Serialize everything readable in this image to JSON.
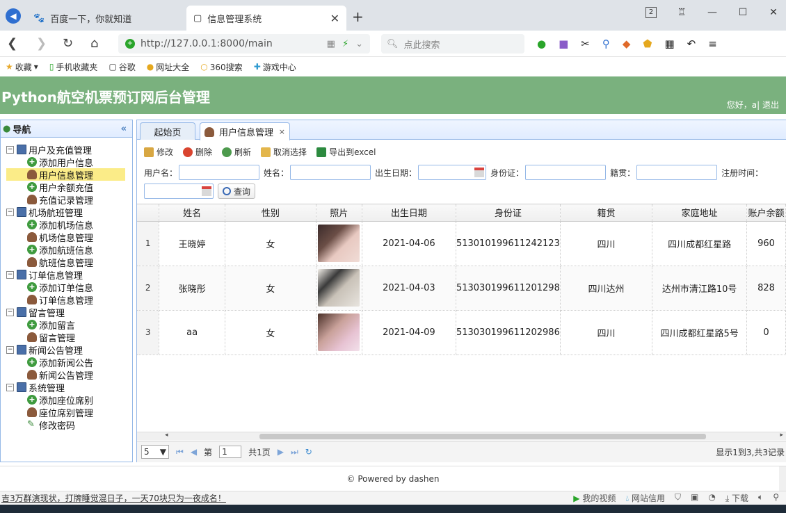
{
  "browser": {
    "tabs": [
      {
        "title": "百度一下，你就知道",
        "active": false
      },
      {
        "title": "信息管理系统",
        "active": true
      }
    ],
    "url": "http://127.0.0.1:8000/main",
    "search_placeholder": "点此搜索",
    "tab_count": "2",
    "bookmarks": [
      "收藏",
      "手机收藏夹",
      "谷歌",
      "网址大全",
      "360搜索",
      "游戏中心"
    ]
  },
  "app": {
    "title": "Python航空机票预订网后台管理",
    "greeting": "您好，a|",
    "logout": "退出"
  },
  "sidebar": {
    "title": "导航",
    "groups": [
      {
        "label": "用户及充值管理",
        "items": [
          {
            "label": "添加用户信息",
            "icon": "plus-icon"
          },
          {
            "label": "用户信息管理",
            "icon": "user-icon",
            "selected": true
          },
          {
            "label": "用户余额充值",
            "icon": "plus-icon"
          },
          {
            "label": "充值记录管理",
            "icon": "user-icon"
          }
        ]
      },
      {
        "label": "机场航班管理",
        "items": [
          {
            "label": "添加机场信息",
            "icon": "plus-icon"
          },
          {
            "label": "机场信息管理",
            "icon": "user-icon"
          },
          {
            "label": "添加航班信息",
            "icon": "plus-icon"
          },
          {
            "label": "航班信息管理",
            "icon": "user-icon"
          }
        ]
      },
      {
        "label": "订单信息管理",
        "items": [
          {
            "label": "添加订单信息",
            "icon": "plus-icon"
          },
          {
            "label": "订单信息管理",
            "icon": "user-icon"
          }
        ]
      },
      {
        "label": "留言管理",
        "items": [
          {
            "label": "添加留言",
            "icon": "plus-icon"
          },
          {
            "label": "留言管理",
            "icon": "user-icon"
          }
        ]
      },
      {
        "label": "新闻公告管理",
        "items": [
          {
            "label": "添加新闻公告",
            "icon": "plus-icon"
          },
          {
            "label": "新闻公告管理",
            "icon": "user-icon"
          }
        ]
      },
      {
        "label": "系统管理",
        "items": [
          {
            "label": "添加座位席别",
            "icon": "plus-icon"
          },
          {
            "label": "座位席别管理",
            "icon": "user-icon"
          },
          {
            "label": "修改密码",
            "icon": "pencil-icon"
          }
        ]
      }
    ]
  },
  "content": {
    "tabs": [
      {
        "label": "起始页",
        "active": false
      },
      {
        "label": "用户信息管理",
        "active": true,
        "close": "×"
      }
    ],
    "toolbar": {
      "edit": "修改",
      "delete": "删除",
      "refresh": "刷新",
      "cancel_select": "取消选择",
      "export": "导出到excel"
    },
    "filter": {
      "username_label": "用户名：",
      "name_label": "姓名：",
      "birth_label": "出生日期：",
      "idcard_label": "身份证：",
      "native_label": "籍贯：",
      "regtime_label": "注册时间：",
      "query_button": "查询"
    },
    "table": {
      "columns": [
        "姓名",
        "性别",
        "照片",
        "出生日期",
        "身份证",
        "籍贯",
        "家庭地址",
        "账户余额"
      ],
      "rows": [
        {
          "no": "1",
          "name": "王晓婷",
          "gender": "女",
          "birth": "2021-04-06",
          "idcard": "513010199611242123",
          "native": "四川",
          "address": "四川成都红星路",
          "balance": "960"
        },
        {
          "no": "2",
          "name": "张晓彤",
          "gender": "女",
          "birth": "2021-04-03",
          "idcard": "513030199611201298",
          "native": "四川达州",
          "address": "达州市清江路10号",
          "balance": "828"
        },
        {
          "no": "3",
          "name": "aa",
          "gender": "女",
          "birth": "2021-04-09",
          "idcard": "513030199611202986",
          "native": "四川",
          "address": "四川成都红星路5号",
          "balance": "0"
        }
      ]
    },
    "pager": {
      "page_size": "5",
      "page_prefix": "第",
      "page_value": "1",
      "page_total": "共1页",
      "info": "显示1到3,共3记录"
    }
  },
  "footer": {
    "powered": "© Powered by dashen"
  },
  "statusbar": {
    "news": "吉3万群演现状，打牌睡觉混日子，一天70块只为一夜成名！",
    "my_video": "我的视频",
    "site_credit": "网站信用",
    "download": "下载"
  }
}
